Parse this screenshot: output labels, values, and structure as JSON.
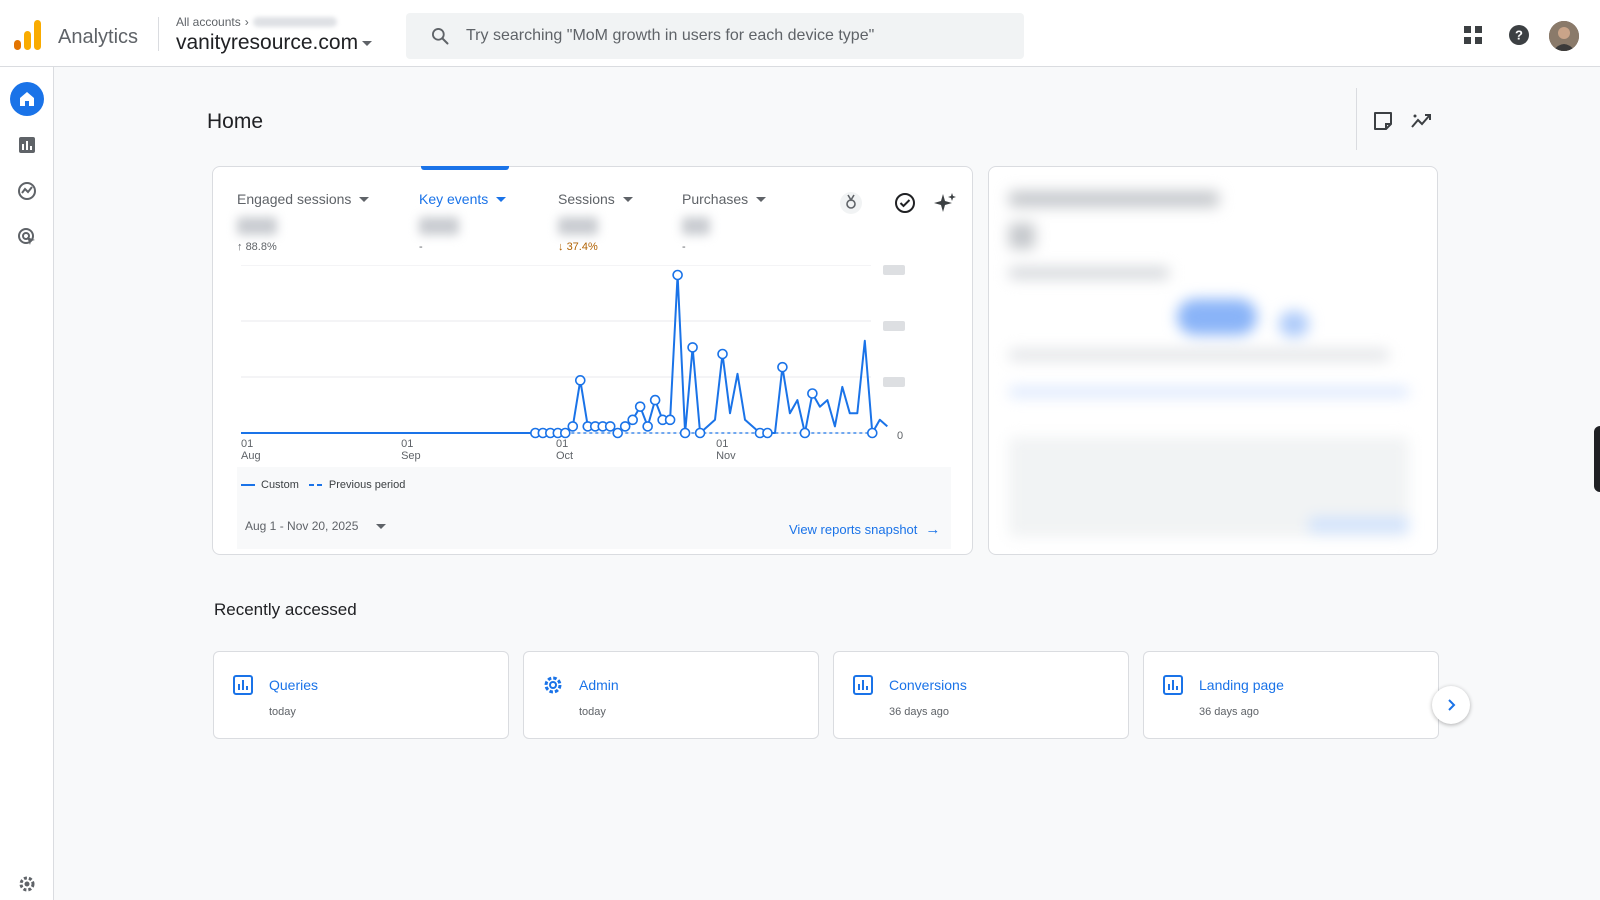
{
  "header": {
    "app_name": "Analytics",
    "breadcrumb_label": "All accounts",
    "property": "vanityresource.com",
    "search_placeholder": "Try searching \"MoM growth in users for each device type\""
  },
  "page": {
    "title": "Home"
  },
  "metrics": [
    {
      "label": "Engaged sessions",
      "change": "88.8%",
      "change_dir": "up",
      "active": false
    },
    {
      "label": "Key events",
      "change": "-",
      "change_dir": "none",
      "active": true
    },
    {
      "label": "Sessions",
      "change": "37.4%",
      "change_dir": "down",
      "active": false
    },
    {
      "label": "Purchases",
      "change": "-",
      "change_dir": "none",
      "active": false
    }
  ],
  "chart_data": {
    "type": "line",
    "x_ticks": [
      {
        "day": "01",
        "month": "Aug"
      },
      {
        "day": "01",
        "month": "Sep"
      },
      {
        "day": "01",
        "month": "Oct"
      },
      {
        "day": "01",
        "month": "Nov"
      }
    ],
    "y_zero_label": "0",
    "series": [
      {
        "name": "Custom",
        "style": "solid",
        "color": "#1a73e8",
        "values": [
          0,
          0,
          0,
          0,
          0,
          0,
          0,
          0,
          0,
          0,
          0,
          0,
          0,
          0,
          0,
          0,
          0,
          0,
          0,
          0,
          0,
          0,
          0,
          0,
          0,
          0,
          0,
          0,
          0,
          0,
          0,
          0,
          0,
          0,
          0,
          0,
          0,
          0,
          0,
          0,
          0,
          0,
          0,
          0,
          0,
          0,
          0,
          0,
          0,
          0,
          0,
          0,
          0,
          0,
          0,
          0,
          0,
          0,
          0,
          0,
          0,
          0,
          0,
          0,
          0,
          0,
          0,
          0,
          0,
          0,
          0,
          0,
          0,
          0,
          0,
          0,
          0,
          0,
          0,
          0,
          0,
          0,
          0,
          0,
          0,
          0,
          0,
          0,
          0,
          0,
          0,
          0,
          0,
          0,
          0,
          0,
          0,
          0,
          0,
          0,
          0,
          0,
          0,
          0,
          0,
          0,
          0,
          0,
          0,
          0,
          0,
          0,
          0,
          0,
          0,
          0,
          0,
          0,
          0,
          0,
          0,
          0,
          0,
          0,
          0,
          0,
          0,
          0,
          0,
          0,
          0,
          0,
          0,
          0,
          0,
          0,
          0,
          0,
          0,
          0,
          0,
          0,
          0,
          0,
          0,
          0,
          0,
          0,
          0,
          0,
          0,
          0,
          0
        ]
      },
      {
        "name": "Previous period",
        "style": "dashed",
        "color": "#1a73e8",
        "values": []
      }
    ],
    "points": [
      [
        0,
        0
      ],
      [
        1,
        0
      ],
      [
        2,
        0
      ],
      [
        3,
        0
      ],
      [
        4,
        0
      ],
      [
        5,
        1
      ],
      [
        6,
        8
      ],
      [
        7,
        1
      ],
      [
        8,
        1
      ],
      [
        9,
        1
      ],
      [
        10,
        1
      ],
      [
        11,
        0
      ],
      [
        12,
        1
      ],
      [
        13,
        2
      ],
      [
        14,
        4
      ],
      [
        15,
        1
      ],
      [
        16,
        5
      ],
      [
        17,
        2
      ],
      [
        18,
        2
      ],
      [
        19,
        24
      ],
      [
        20,
        0
      ],
      [
        21,
        13
      ],
      [
        22,
        0
      ],
      [
        23,
        1
      ],
      [
        24,
        2
      ],
      [
        25,
        12
      ],
      [
        26,
        3
      ],
      [
        27,
        9
      ],
      [
        28,
        2
      ],
      [
        29,
        1
      ],
      [
        30,
        0
      ],
      [
        31,
        0
      ],
      [
        32,
        0
      ],
      [
        33,
        10
      ],
      [
        34,
        3
      ],
      [
        35,
        5
      ],
      [
        36,
        0
      ],
      [
        37,
        6
      ],
      [
        38,
        4
      ],
      [
        39,
        5
      ],
      [
        40,
        1
      ],
      [
        41,
        7
      ],
      [
        42,
        3
      ],
      [
        43,
        3
      ],
      [
        44,
        14
      ],
      [
        45,
        0
      ],
      [
        46,
        2
      ],
      [
        47,
        1
      ]
    ]
  },
  "legend": {
    "current": "Custom",
    "previous": "Previous period"
  },
  "date_range": "Aug 1 - Nov 20, 2025",
  "view_link": "View reports snapshot",
  "recent": {
    "title": "Recently accessed",
    "items": [
      {
        "label": "Queries",
        "time": "today",
        "icon": "bar-chart-icon"
      },
      {
        "label": "Admin",
        "time": "today",
        "icon": "gear-icon"
      },
      {
        "label": "Conversions",
        "time": "36 days ago",
        "icon": "bar-chart-icon"
      },
      {
        "label": "Landing page",
        "time": "36 days ago",
        "icon": "bar-chart-icon"
      }
    ]
  },
  "colors": {
    "accent": "#1a73e8",
    "down": "#b06000",
    "logo_orange": "#f9ab00",
    "logo_dark": "#e37400"
  }
}
